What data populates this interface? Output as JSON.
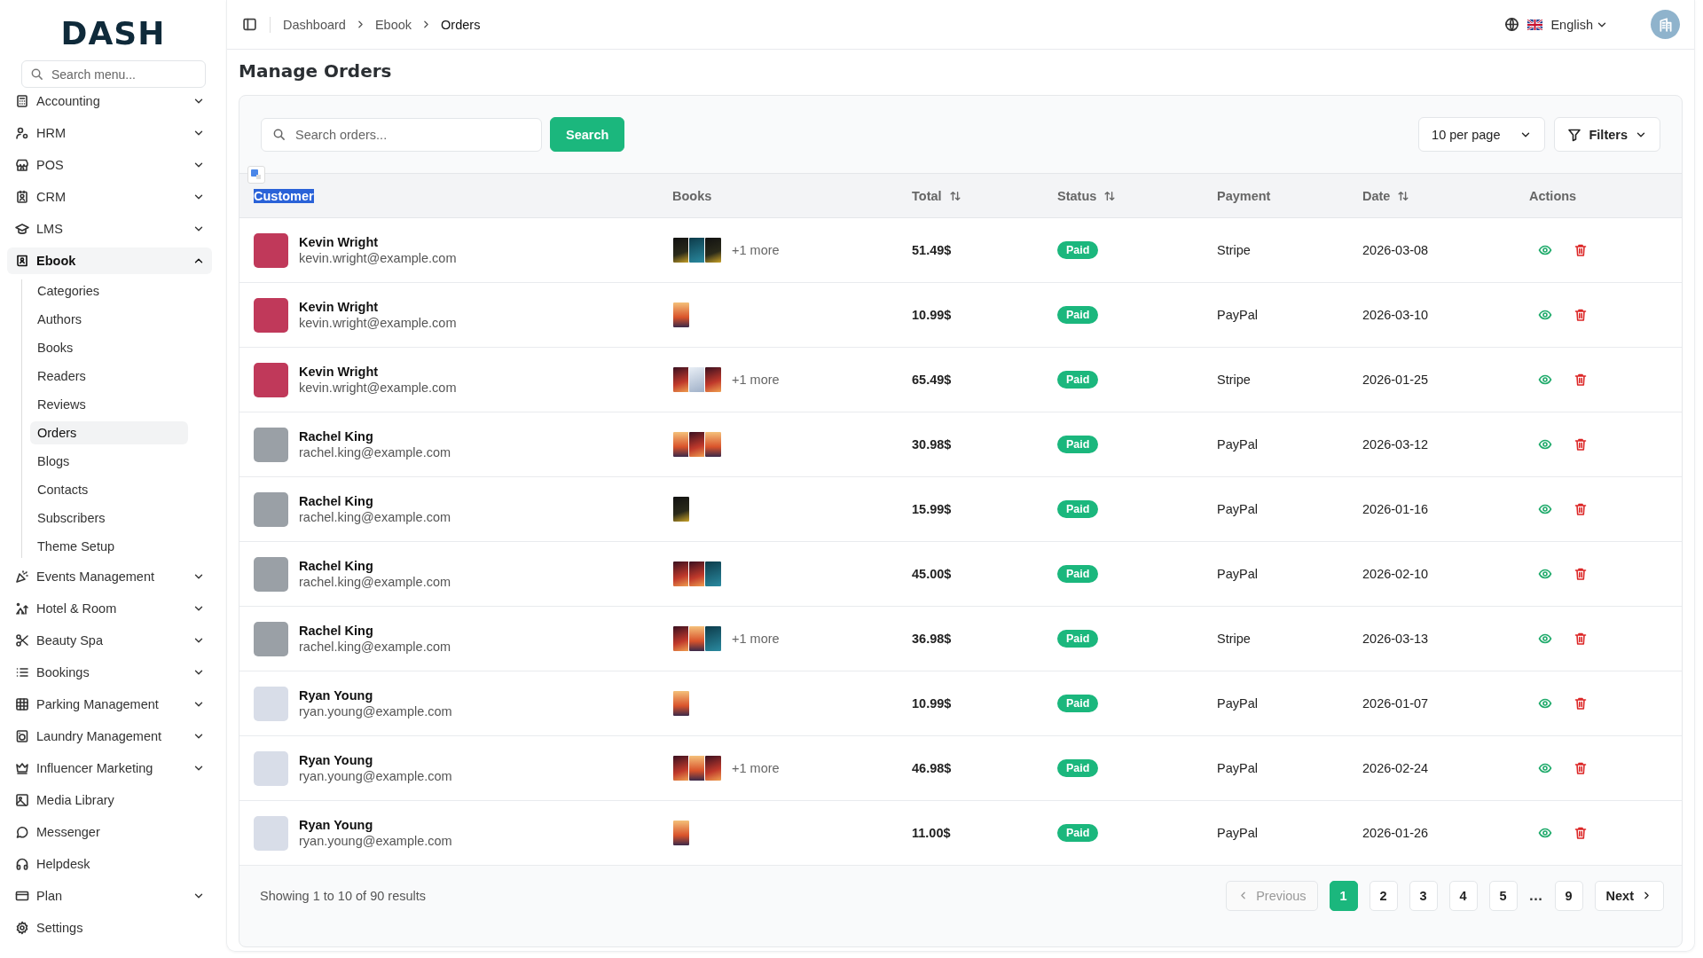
{
  "sidebar": {
    "logo": "DASH",
    "search": {
      "placeholder": "Search menu..."
    },
    "items": [
      {
        "label": "Accounting",
        "has_submenu": true,
        "expanded": false
      },
      {
        "label": "HRM",
        "has_submenu": true,
        "expanded": false
      },
      {
        "label": "POS",
        "has_submenu": true,
        "expanded": false
      },
      {
        "label": "CRM",
        "has_submenu": true,
        "expanded": false
      },
      {
        "label": "LMS",
        "has_submenu": true,
        "expanded": false
      },
      {
        "label": "Ebook",
        "has_submenu": true,
        "expanded": true,
        "children": [
          {
            "label": "Categories",
            "selected": false
          },
          {
            "label": "Authors",
            "selected": false
          },
          {
            "label": "Books",
            "selected": false
          },
          {
            "label": "Readers",
            "selected": false
          },
          {
            "label": "Reviews",
            "selected": false
          },
          {
            "label": "Orders",
            "selected": true
          },
          {
            "label": "Blogs",
            "selected": false
          },
          {
            "label": "Contacts",
            "selected": false
          },
          {
            "label": "Subscribers",
            "selected": false
          },
          {
            "label": "Theme Setup",
            "selected": false
          }
        ]
      },
      {
        "label": "Events Management",
        "has_submenu": true,
        "expanded": false
      },
      {
        "label": "Hotel & Room",
        "has_submenu": true,
        "expanded": false
      },
      {
        "label": "Beauty Spa",
        "has_submenu": true,
        "expanded": false
      },
      {
        "label": "Bookings",
        "has_submenu": true,
        "expanded": false
      },
      {
        "label": "Parking Management",
        "has_submenu": true,
        "expanded": false
      },
      {
        "label": "Laundry Management",
        "has_submenu": true,
        "expanded": false
      },
      {
        "label": "Influencer Marketing",
        "has_submenu": true,
        "expanded": false
      },
      {
        "label": "Media Library",
        "has_submenu": false,
        "expanded": false
      },
      {
        "label": "Messenger",
        "has_submenu": false,
        "expanded": false
      },
      {
        "label": "Helpdesk",
        "has_submenu": false,
        "expanded": false
      },
      {
        "label": "Plan",
        "has_submenu": true,
        "expanded": false
      },
      {
        "label": "Settings",
        "has_submenu": false,
        "expanded": false
      }
    ]
  },
  "header": {
    "breadcrumbs": [
      "Dashboard",
      "Ebook",
      "Orders"
    ],
    "language": "English"
  },
  "page": {
    "title": "Manage Orders"
  },
  "toolbar": {
    "search": {
      "placeholder": "Search orders..."
    },
    "search_button": "Search",
    "per_page": "10 per page",
    "filters": "Filters"
  },
  "table": {
    "columns": [
      {
        "label": "Customer",
        "sortable": false,
        "highlighted": true
      },
      {
        "label": "Books",
        "sortable": false,
        "highlighted": false
      },
      {
        "label": "Total",
        "sortable": true,
        "highlighted": false
      },
      {
        "label": "Status",
        "sortable": true,
        "highlighted": false
      },
      {
        "label": "Payment",
        "sortable": false,
        "highlighted": false
      },
      {
        "label": "Date",
        "sortable": true,
        "highlighted": false
      },
      {
        "label": "Actions",
        "sortable": false,
        "highlighted": false
      }
    ],
    "rows": [
      {
        "name": "Kevin Wright",
        "email": "kevin.wright@example.com",
        "covers": [
          {
            "kind": "dark"
          },
          {
            "kind": "teal"
          },
          {
            "kind": "dark"
          }
        ],
        "more": "+1 more",
        "total": "51.49$",
        "status": "Paid",
        "payment": "Stripe",
        "date": "2026-03-08"
      },
      {
        "name": "Kevin Wright",
        "email": "kevin.wright@example.com",
        "covers": [
          {
            "kind": "sunset"
          }
        ],
        "total": "10.99$",
        "status": "Paid",
        "payment": "PayPal",
        "date": "2026-03-10"
      },
      {
        "name": "Kevin Wright",
        "email": "kevin.wright@example.com",
        "covers": [
          {
            "kind": "red"
          },
          {
            "kind": "light"
          },
          {
            "kind": "red"
          }
        ],
        "more": "+1 more",
        "total": "65.49$",
        "status": "Paid",
        "payment": "Stripe",
        "date": "2026-01-25"
      },
      {
        "name": "Rachel King",
        "email": "rachel.king@example.com",
        "covers": [
          {
            "kind": "sunset"
          },
          {
            "kind": "red"
          },
          {
            "kind": "sunset"
          }
        ],
        "total": "30.98$",
        "status": "Paid",
        "payment": "PayPal",
        "date": "2026-03-12"
      },
      {
        "name": "Rachel King",
        "email": "rachel.king@example.com",
        "covers": [
          {
            "kind": "dark"
          }
        ],
        "total": "15.99$",
        "status": "Paid",
        "payment": "PayPal",
        "date": "2026-01-16"
      },
      {
        "name": "Rachel King",
        "email": "rachel.king@example.com",
        "covers": [
          {
            "kind": "red"
          },
          {
            "kind": "red"
          },
          {
            "kind": "teal"
          }
        ],
        "total": "45.00$",
        "status": "Paid",
        "payment": "PayPal",
        "date": "2026-02-10"
      },
      {
        "name": "Rachel King",
        "email": "rachel.king@example.com",
        "covers": [
          {
            "kind": "red"
          },
          {
            "kind": "sunset"
          },
          {
            "kind": "teal"
          }
        ],
        "more": "+1 more",
        "total": "36.98$",
        "status": "Paid",
        "payment": "Stripe",
        "date": "2026-03-13"
      },
      {
        "name": "Ryan Young",
        "email": "ryan.young@example.com",
        "covers": [
          {
            "kind": "sunset"
          }
        ],
        "total": "10.99$",
        "status": "Paid",
        "payment": "PayPal",
        "date": "2026-01-07"
      },
      {
        "name": "Ryan Young",
        "email": "ryan.young@example.com",
        "covers": [
          {
            "kind": "red"
          },
          {
            "kind": "sunset"
          },
          {
            "kind": "red"
          }
        ],
        "more": "+1 more",
        "total": "46.98$",
        "status": "Paid",
        "payment": "PayPal",
        "date": "2026-02-24"
      },
      {
        "name": "Ryan Young",
        "email": "ryan.young@example.com",
        "covers": [
          {
            "kind": "sunset"
          }
        ],
        "total": "11.00$",
        "status": "Paid",
        "payment": "PayPal",
        "date": "2026-01-26"
      }
    ]
  },
  "footer": {
    "summary": "Showing 1 to 10 of 90 results",
    "previous": {
      "label": "Previous",
      "disabled": true
    },
    "pages": [
      {
        "label": "1",
        "kind": "page",
        "selected": true
      },
      {
        "label": "2",
        "kind": "page",
        "selected": false
      },
      {
        "label": "3",
        "kind": "page",
        "selected": false
      },
      {
        "label": "4",
        "kind": "page",
        "selected": false
      },
      {
        "label": "5",
        "kind": "page",
        "selected": false
      },
      {
        "label": "…",
        "kind": "ellipsis"
      },
      {
        "label": "9",
        "kind": "page",
        "selected": false
      }
    ],
    "next": {
      "label": "Next",
      "disabled": false
    }
  }
}
